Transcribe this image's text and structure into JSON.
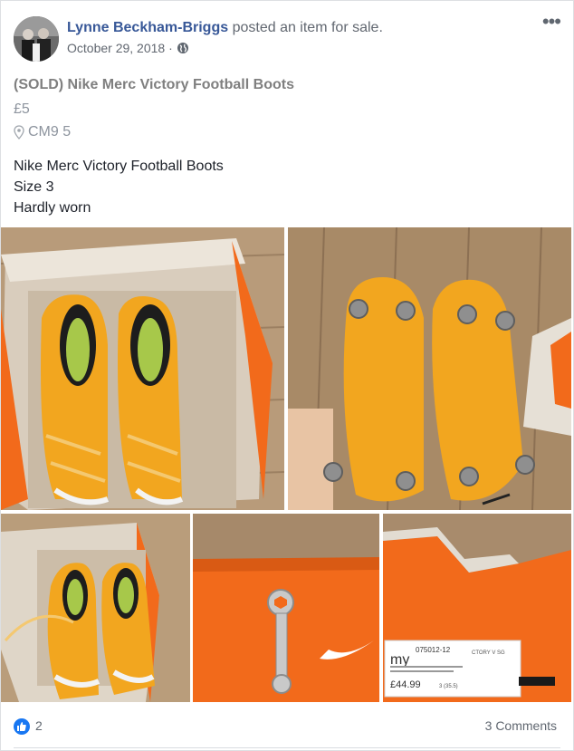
{
  "post": {
    "author_name": "Lynne Beckham-Briggs",
    "action_text": "posted an item for sale.",
    "date": "October 29, 2018 ·",
    "more_label": "•••"
  },
  "listing": {
    "title": "(SOLD) Nike Merc Victory Football Boots",
    "price": "£5",
    "location": "CM9 5",
    "description": [
      "Nike Merc Victory Football Boots",
      "Size 3",
      "Hardly worn"
    ]
  },
  "photos": {
    "box_label_brand": "my",
    "box_label_code": "075012-12",
    "box_label_price": "£44.99",
    "box_label_size": "3 (35.5)",
    "box_label_model": "CTORY V SG"
  },
  "footer": {
    "like_count": "2",
    "comments_label": "3 Comments"
  },
  "colors": {
    "link": "#385898",
    "like": "#1877f2",
    "boot_yellow": "#f2a61f",
    "box_orange": "#f26a1b"
  }
}
